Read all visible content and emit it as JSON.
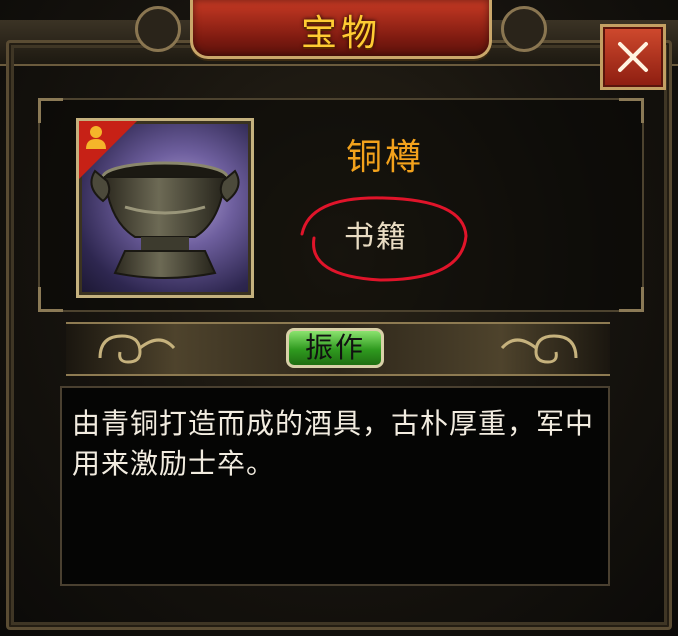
{
  "window": {
    "title": "宝物",
    "close_icon": "close-x-icon"
  },
  "item": {
    "name": "铜樽",
    "type": "书籍",
    "tag": "振作",
    "description": "由青铜打造而成的酒具，古朴厚重，军中用来激励士卒。",
    "image": "bronze-wine-vessel-icon",
    "badge_icon": "person-icon"
  },
  "colors": {
    "title_text": "#ffcc33",
    "item_name": "#f3a21c",
    "tag_green": "#2f9a1f",
    "annotation_red": "#e0142a",
    "close_red": "#b5321f"
  }
}
